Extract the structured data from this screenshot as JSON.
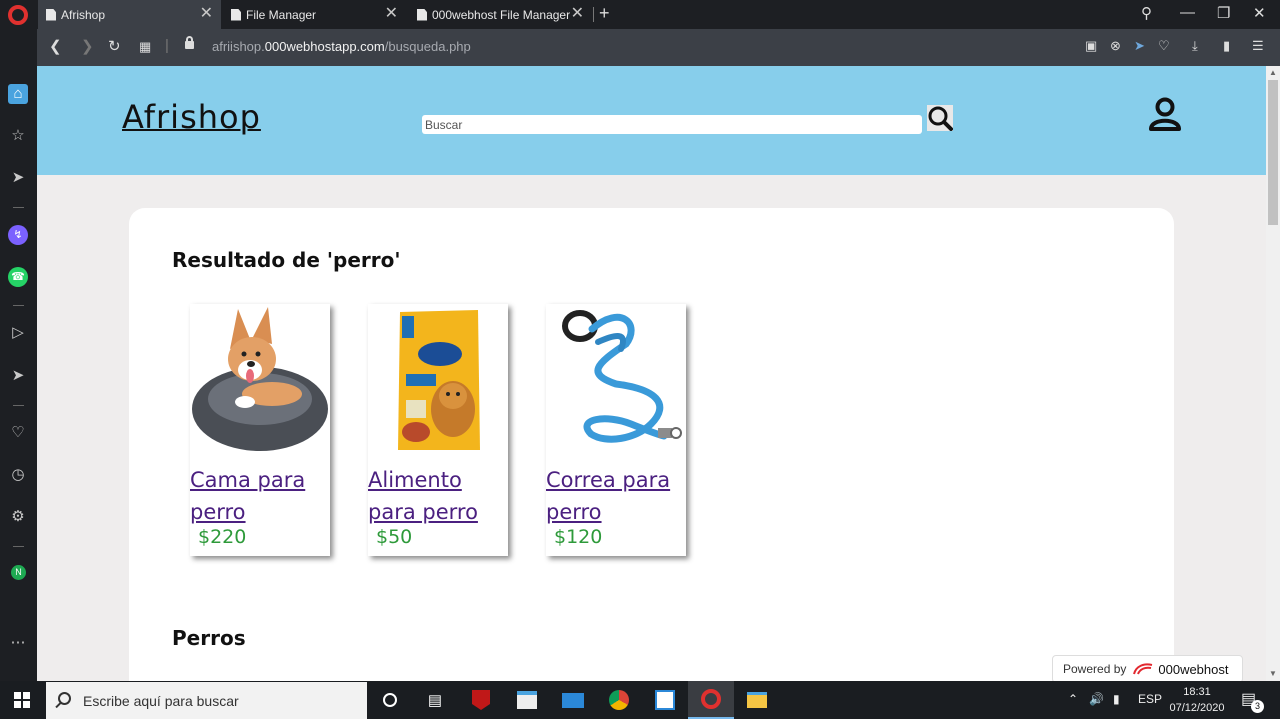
{
  "browser": {
    "tabs": [
      {
        "label": "Afrishop",
        "active": true
      },
      {
        "label": "File Manager",
        "active": false
      },
      {
        "label": "000webhost File Manager",
        "active": false
      }
    ],
    "url_prefix": "afriishop.",
    "url_domain": "000webhostapp.com",
    "url_path": "/busqueda.php"
  },
  "header": {
    "brand": "Afrishop",
    "search_placeholder": "Buscar",
    "bg_color": "#87ceeb"
  },
  "results": {
    "title": "Resultado de 'perro'",
    "products": [
      {
        "name": "Cama para perro",
        "price": "$220",
        "image": "dog-bed-image"
      },
      {
        "name": "Alimento para perro",
        "price": "$50",
        "image": "dog-food-bag-image"
      },
      {
        "name": "Correa para perro",
        "price": "$120",
        "image": "dog-leash-image"
      }
    ]
  },
  "section2": {
    "title": "Perros"
  },
  "powered": {
    "label": "Powered by",
    "host": "000webhost"
  },
  "taskbar": {
    "search_placeholder": "Escribe aquí para buscar",
    "lang": "ESP",
    "time": "18:31",
    "date": "07/12/2020",
    "notifications": "3"
  }
}
